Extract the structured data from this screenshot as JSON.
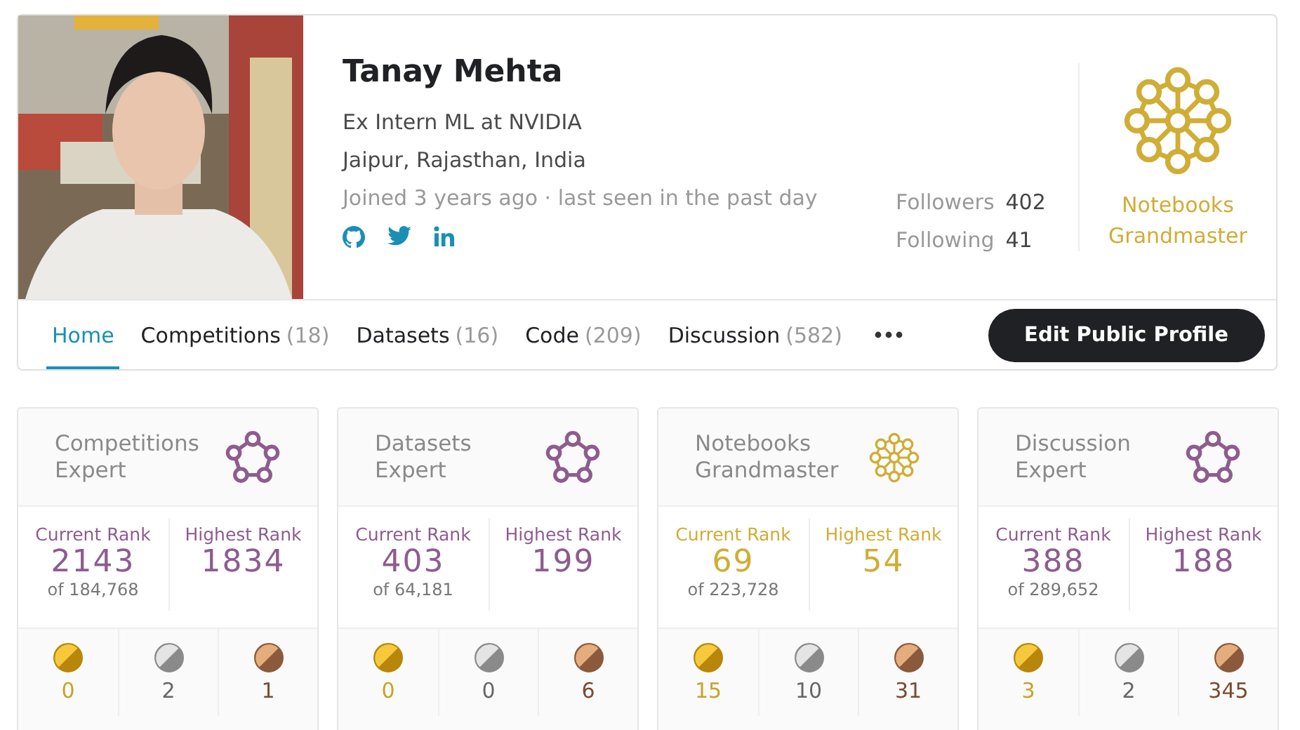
{
  "profile": {
    "name": "Tanay Mehta",
    "occupation": "Ex Intern ML at NVIDIA",
    "location": "Jaipur, Rajasthan, India",
    "activity": "Joined 3 years ago · last seen in the past day",
    "socials": [
      {
        "kind": "github"
      },
      {
        "kind": "twitter"
      },
      {
        "kind": "linkedin"
      }
    ],
    "followers": {
      "label": "Followers",
      "count": "402"
    },
    "following": {
      "label": "Following",
      "count": "41"
    },
    "highest_tier": {
      "kind": "grandmaster",
      "label": "Notebooks Grandmaster"
    }
  },
  "tabs": [
    {
      "label": "Home",
      "selected": true
    },
    {
      "label": "Competitions",
      "count": "(18)",
      "selected": false
    },
    {
      "label": "Datasets",
      "count": "(16)",
      "selected": false
    },
    {
      "label": "Code",
      "count": "(209)",
      "selected": false
    },
    {
      "label": "Discussion",
      "count": "(582)",
      "selected": false
    }
  ],
  "edit_button": "Edit Public Profile",
  "stat_cards": [
    {
      "title": "Competitions Expert",
      "kind": "expert",
      "current_label": "Current Rank",
      "current": "2143",
      "of": "of 184,768",
      "highest_label": "Highest Rank",
      "highest": "1834",
      "medals": [
        {
          "kind": "gold",
          "count": "0"
        },
        {
          "kind": "silver",
          "count": "2"
        },
        {
          "kind": "bronze",
          "count": "1"
        }
      ]
    },
    {
      "title": "Datasets Expert",
      "kind": "expert",
      "current_label": "Current Rank",
      "current": "403",
      "of": "of 64,181",
      "highest_label": "Highest Rank",
      "highest": "199",
      "medals": [
        {
          "kind": "gold",
          "count": "0"
        },
        {
          "kind": "silver",
          "count": "0"
        },
        {
          "kind": "bronze",
          "count": "6"
        }
      ]
    },
    {
      "title": "Notebooks Grandmaster",
      "kind": "grandmaster",
      "current_label": "Current Rank",
      "current": "69",
      "of": "of 223,728",
      "highest_label": "Highest Rank",
      "highest": "54",
      "medals": [
        {
          "kind": "gold",
          "count": "15"
        },
        {
          "kind": "silver",
          "count": "10"
        },
        {
          "kind": "bronze",
          "count": "31"
        }
      ]
    },
    {
      "title": "Discussion Expert",
      "kind": "expert",
      "current_label": "Current Rank",
      "current": "388",
      "of": "of 289,652",
      "highest_label": "Highest Rank",
      "highest": "188",
      "medals": [
        {
          "kind": "gold",
          "count": "3"
        },
        {
          "kind": "silver",
          "count": "2"
        },
        {
          "kind": "bronze",
          "count": "345"
        }
      ]
    }
  ]
}
